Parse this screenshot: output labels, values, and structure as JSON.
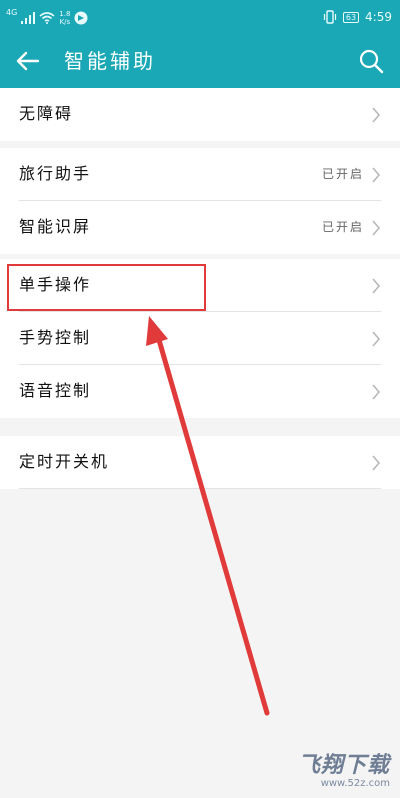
{
  "status_bar": {
    "signal": "4G",
    "net_speed_value": "1.8",
    "net_speed_unit": "K/s",
    "battery": "63",
    "time": "4:59"
  },
  "app_bar": {
    "title": "智能辅助",
    "back_icon": "arrow-left-icon",
    "search_icon": "search-icon"
  },
  "sections": [
    {
      "items": [
        {
          "label": "无障碍",
          "status": ""
        }
      ]
    },
    {
      "items": [
        {
          "label": "旅行助手",
          "status": "已开启"
        },
        {
          "label": "智能识屏",
          "status": "已开启"
        }
      ]
    },
    {
      "items": [
        {
          "label": "单手操作",
          "status": ""
        },
        {
          "label": "手势控制",
          "status": ""
        },
        {
          "label": "语音控制",
          "status": ""
        }
      ]
    },
    {
      "items": [
        {
          "label": "定时开关机",
          "status": ""
        }
      ]
    }
  ],
  "annotation": {
    "color": "#e03a3a"
  },
  "colors": {
    "accent": "#1aa7b6"
  },
  "watermark": {
    "main": "飞翔下载",
    "sub": "www.52z.com"
  }
}
